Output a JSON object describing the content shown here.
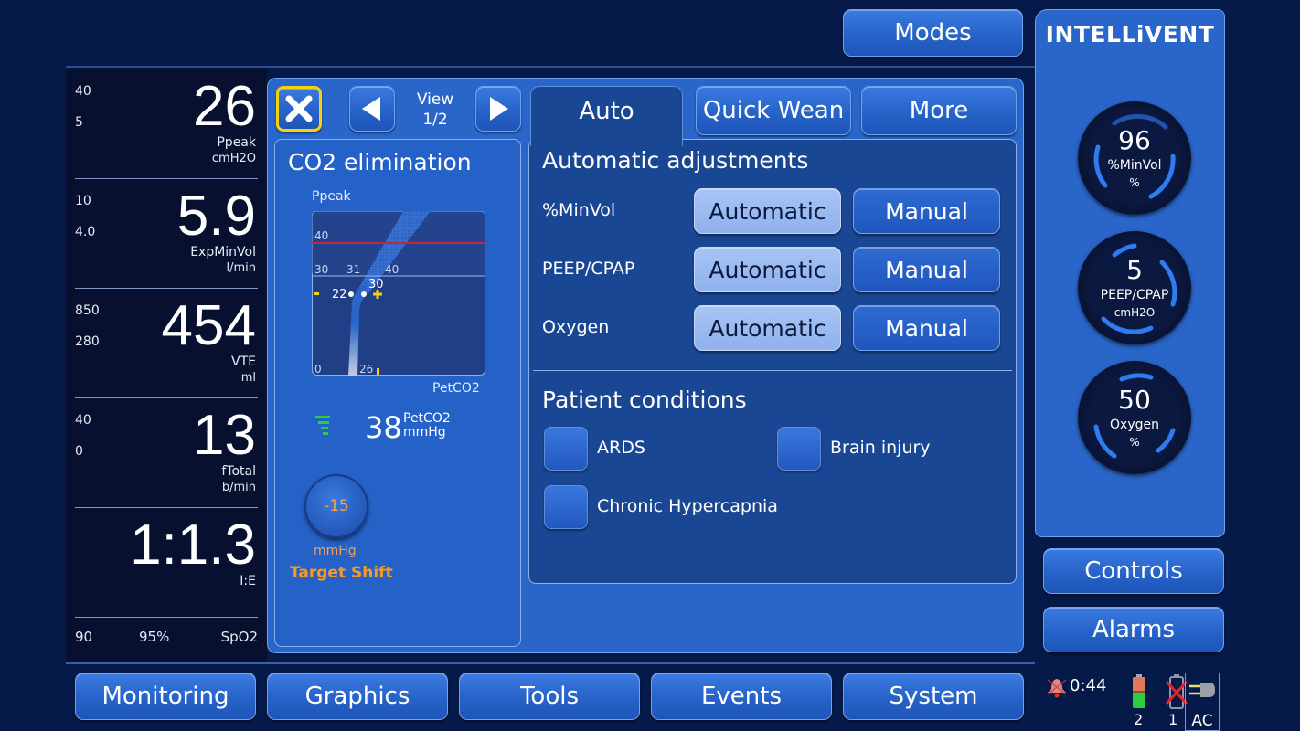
{
  "top": {
    "modes_label": "Modes",
    "intellivent_label": "INTELLiVENT"
  },
  "monitoring": [
    {
      "high": "40",
      "low": "5",
      "value": "26",
      "name": "Ppeak",
      "unit": "cmH2O"
    },
    {
      "high": "10",
      "low": "4.0",
      "value": "5.9",
      "name": "ExpMinVol",
      "unit": "l/min"
    },
    {
      "high": "850",
      "low": "280",
      "value": "454",
      "name": "VTE",
      "unit": "ml"
    },
    {
      "high": "40",
      "low": "0",
      "value": "13",
      "name": "fTotal",
      "unit": "b/min"
    },
    {
      "high": "",
      "low": "",
      "value": "1:1.3",
      "name": "I:E",
      "unit": ""
    }
  ],
  "spo2": {
    "low": "90",
    "value": "95%",
    "name": "SpO2"
  },
  "toolbar": {
    "view_label": "View",
    "view_page": "1/2"
  },
  "co2_panel": {
    "title": "CO2 elimination",
    "y_axis_label": "Ppeak",
    "x_axis_label": "PetCO2",
    "petco2_value": "38",
    "petco2_name": "PetCO2",
    "petco2_unit": "mmHg",
    "target_shift_value": "-15",
    "target_shift_unit": "mmHg",
    "target_shift_label": "Target Shift",
    "chart": {
      "ppeak_limit": "40",
      "ppeak_ref": "30",
      "ppeak_zero": "0",
      "petco2_ticks": [
        "31",
        "40"
      ],
      "current_ppeak": "22",
      "target_ppeak": "30",
      "petco2_marker": "26"
    }
  },
  "tabs": [
    {
      "label": "Auto",
      "active": true
    },
    {
      "label": "Quick Wean",
      "active": false
    },
    {
      "label": "More",
      "active": false
    }
  ],
  "auto_adjustments": {
    "title": "Automatic adjustments",
    "rows": [
      {
        "label": "%MinVol",
        "automatic": "Automatic",
        "manual": "Manual",
        "selected": "Automatic"
      },
      {
        "label": "PEEP/CPAP",
        "automatic": "Automatic",
        "manual": "Manual",
        "selected": "Automatic"
      },
      {
        "label": "Oxygen",
        "automatic": "Automatic",
        "manual": "Manual",
        "selected": "Automatic"
      }
    ]
  },
  "patient_conditions": {
    "title": "Patient conditions",
    "items": [
      {
        "label": "ARDS",
        "checked": false
      },
      {
        "label": "Brain injury",
        "checked": false
      },
      {
        "label": "Chronic Hypercapnia",
        "checked": false
      }
    ]
  },
  "dials": [
    {
      "value": "96",
      "name": "%MinVol",
      "unit": "%"
    },
    {
      "value": "5",
      "name": "PEEP/CPAP",
      "unit": "cmH2O"
    },
    {
      "value": "50",
      "name": "Oxygen",
      "unit": "%"
    }
  ],
  "side_buttons": {
    "controls": "Controls",
    "alarms": "Alarms"
  },
  "nav": [
    "Monitoring",
    "Graphics",
    "Tools",
    "Events",
    "System"
  ],
  "status": {
    "alarm_silence_time": "0:44",
    "battery_2_label": "2",
    "battery_1_label": "1",
    "ac_label": "AC"
  },
  "colors": {
    "background": "#061a4a",
    "panel": "#2a66c9",
    "active_panel": "#1a4793",
    "limit_line": "#c0283c",
    "accent_yellow": "#f5d20f",
    "target_shift_orange": "#f49a2a"
  }
}
